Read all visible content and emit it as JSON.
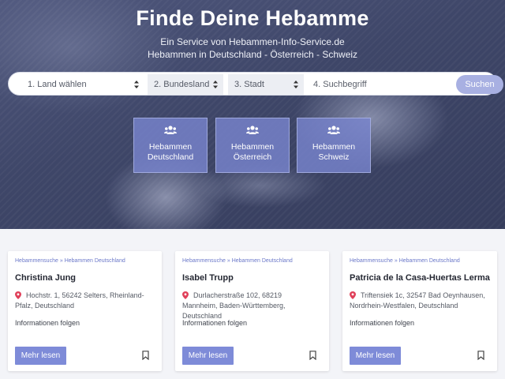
{
  "hero": {
    "title": "Finde Deine Hebamme",
    "subtitle_line1": "Ein Service von Hebammen-Info-Service.de",
    "subtitle_line2": "Hebammen in Deutschland - Österreich - Schweiz"
  },
  "search": {
    "country_select": "1. Land wählen",
    "state_select": "2. Bundesland",
    "city_select": "3. Stadt",
    "query_placeholder": "4. Suchbegriff",
    "query_value": "",
    "submit_label": "Suchen"
  },
  "tiles": [
    {
      "icon": "users-icon",
      "line1": "Hebammen",
      "line2": "Deutschland"
    },
    {
      "icon": "users-icon",
      "line1": "Hebammen",
      "line2": "Österreich"
    },
    {
      "icon": "users-icon",
      "line1": "Hebammen",
      "line2": "Schweiz"
    }
  ],
  "cards": [
    {
      "crumb_1": "Hebammensuche",
      "crumb_sep": "»",
      "crumb_2": "Hebammen Deutschland",
      "name": "Christina Jung",
      "address": "Hochstr. 1, 56242 Selters, Rheinland-Pfalz, Deutschland",
      "info": "Informationen folgen",
      "button": "Mehr lesen"
    },
    {
      "crumb_1": "Hebammensuche",
      "crumb_sep": "»",
      "crumb_2": "Hebammen Deutschland",
      "name": "Isabel Trupp",
      "address": "Durlacherstraße 102, 68219 Mannheim, Baden-Württemberg, Deutschland",
      "info": "Informationen folgen",
      "button": "Mehr lesen"
    },
    {
      "crumb_1": "Hebammensuche",
      "crumb_sep": "»",
      "crumb_2": "Hebammen Deutschland",
      "name": "Patricia de la Casa-Huertas Lerma",
      "address": "Triftensiek 1c, 32547 Bad Oeynhausen, Nordrhein-Westfalen, Deutschland",
      "info": "Informationen folgen",
      "button": "Mehr lesen"
    }
  ],
  "colors": {
    "accent": "#7e8bd8",
    "search_button": "#a8b0e2",
    "pin": "#e0405a",
    "link": "#6b78c9"
  }
}
